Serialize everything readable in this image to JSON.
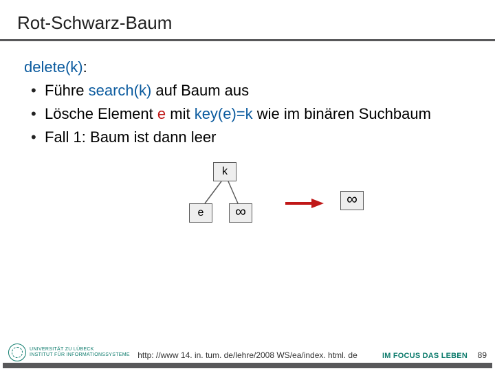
{
  "title": "Rot-Schwarz-Baum",
  "func": {
    "delete_label": "delete(k)",
    "search_label": "search(k)"
  },
  "text": {
    "colon": ":",
    "bullet1_pre": "Führe ",
    "bullet1_post": " auf Baum aus",
    "bullet2_pre": "Lösche Element ",
    "e": "e",
    "bullet2_mid": " mit ",
    "keyexpr": "key(e)=k",
    "bullet2_post": " wie im binären Suchbaum",
    "bullet3": "Fall 1: Baum ist dann leer"
  },
  "diagram": {
    "k": "k",
    "e": "e",
    "infinity1": "∞",
    "infinity2": "∞"
  },
  "footer": {
    "uni_line1": "UNIVERSITÄT ZU LÜBECK",
    "uni_line2": "INSTITUT FÜR INFORMATIONSSYSTEME",
    "url": "http: //www 14. in. tum. de/lehre/2008 WS/ea/index. html. de",
    "tagline_pre": "IM ",
    "tagline_focus": "FOCUS",
    "tagline_post": " DAS LEBEN",
    "page": "89"
  }
}
